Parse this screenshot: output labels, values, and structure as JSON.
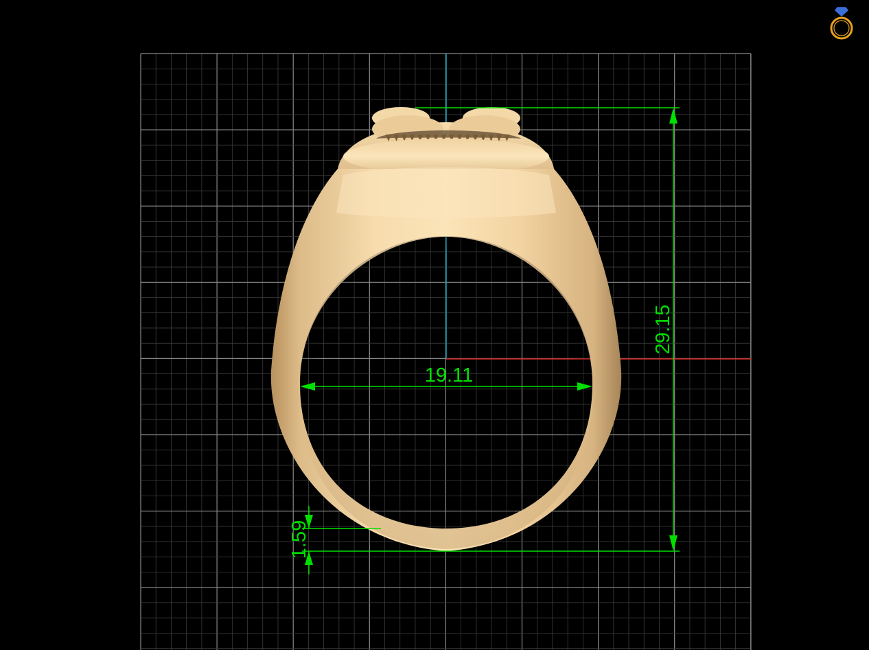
{
  "viewport": {
    "background": "#000000",
    "grid_major_color": "#8a8a8a",
    "grid_minor_color": "#3c3c3c",
    "axis_y_color": "#1aa3b8",
    "axis_x_color": "#d42020",
    "dimension_color": "#00e000"
  },
  "model": {
    "icon": "ring-3d-model",
    "color": "#f2cf9c"
  },
  "dimensions": {
    "inner_diameter": "19.11",
    "total_height": "29.15",
    "shank_thickness": "1.59"
  },
  "logo": {
    "icon": "ring-with-diamond-icon",
    "ring_color": "#e8a21c",
    "gem_color": "#3a6fd8"
  }
}
